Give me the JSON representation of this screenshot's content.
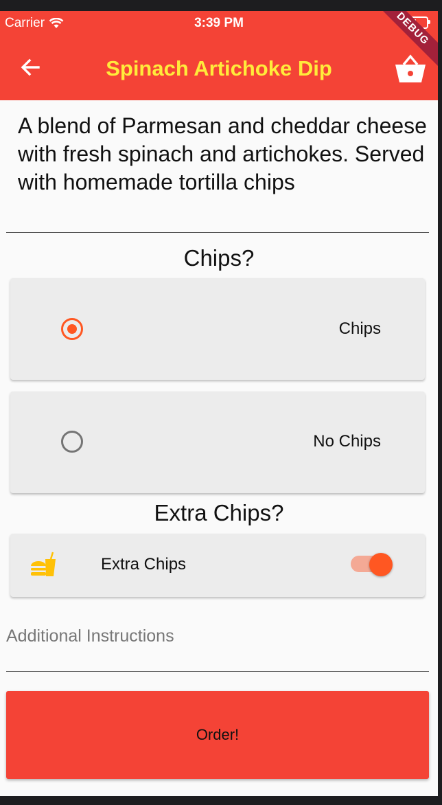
{
  "status_bar": {
    "carrier": "Carrier",
    "time": "3:39 PM"
  },
  "app_bar": {
    "title": "Spinach Artichoke Dip",
    "debug_banner": "DEBUG",
    "title_color": "#ffeb3b",
    "bar_color": "#f44336"
  },
  "description": "A blend of Parmesan and cheddar cheese with fresh spinach and artichokes. Served with homemade tortilla chips",
  "chips_section": {
    "title": "Chips?",
    "options": [
      {
        "label": "Chips",
        "selected": true
      },
      {
        "label": "No Chips",
        "selected": false
      }
    ]
  },
  "extra_section": {
    "title": "Extra Chips?",
    "toggle_label": "Extra Chips",
    "toggle_on": true,
    "icon": "fastfood-icon"
  },
  "instructions": {
    "placeholder": "Additional Instructions"
  },
  "order_button": {
    "label": "Order!"
  }
}
